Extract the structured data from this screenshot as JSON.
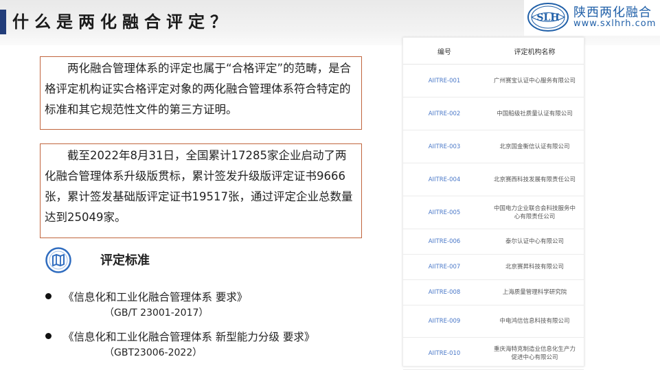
{
  "header": {
    "title": "什么是两化融合评定？",
    "accent_color": "#223d7a",
    "brand_name": "陕西两化融合",
    "brand_url": "www.sxlhrh.com",
    "brand_logo_letters": "SLH"
  },
  "intro": {
    "paragraph1": "两化融合管理体系的评定也属于“合格评定”的范畴，是合格评定机构证实合格评定对象的两化融合管理体系符合特定的标准和其它规范性文件的第三方证明。",
    "paragraph2": "截至2022年8月31日，全国累计17285家企业启动了两化融合管理体系升级版贯标，累计签发升级版评定证书9666张，累计签发基础版评定证书19517张，通过评定企业总数量达到25049家。",
    "border_color": "#c0643c"
  },
  "standards": {
    "heading": "评定标准",
    "icon": "map-icon",
    "items": [
      {
        "name": "《信息化和工业化融合管理体系 要求》",
        "code": "（GB/T 23001-2017）"
      },
      {
        "name": "《信息化和工业化融合管理体系 新型能力分级 要求》",
        "code": "（GBT23006-2022）"
      }
    ]
  },
  "org_table": {
    "columns": [
      "编号",
      "评定机构名称"
    ],
    "code_color": "#4a78c8",
    "rows": [
      {
        "code": "AIITRE-001",
        "name": "广州赛宝认证中心服务有限公司"
      },
      {
        "code": "AIITRE-002",
        "name": "中国船级社质量认证有限公司"
      },
      {
        "code": "AIITRE-003",
        "name": "北京国金衡信认证有限公司"
      },
      {
        "code": "AIITRE-004",
        "name": "北京赛西科技发展有限责任公司"
      },
      {
        "code": "AIITRE-005",
        "name": "中国电力企业联合会科技服务中心有限责任公司"
      },
      {
        "code": "AIITRE-006",
        "name": "泰尔认证中心有限公司"
      },
      {
        "code": "AIITRE-007",
        "name": "北京赛昇科技有限公司"
      },
      {
        "code": "AIITRE-008",
        "name": "上海质量管理科学研究院"
      },
      {
        "code": "AIITRE-009",
        "name": "中电鸿信信息科技有限公司"
      },
      {
        "code": "AIITRE-010",
        "name": "重庆海特克制造业信息化生产力促进中心有限公司"
      }
    ]
  }
}
